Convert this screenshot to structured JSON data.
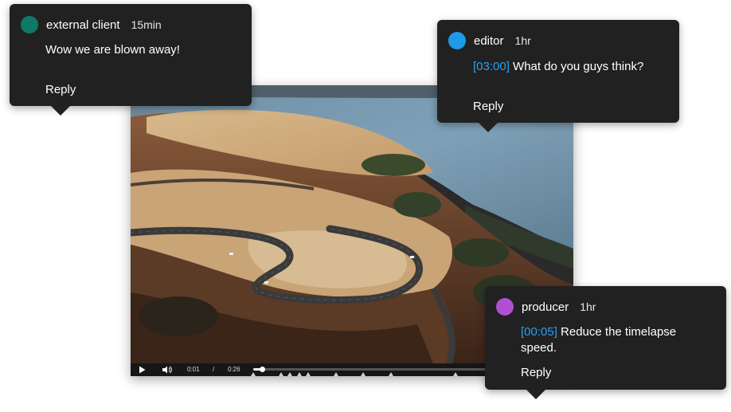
{
  "video": {
    "current_time": "0:01",
    "separator": "/",
    "duration": "0:26",
    "progress_fraction": 0.038,
    "comment_marker_times": [
      "0:00",
      "0:03",
      "0:04",
      "0:05",
      "0:06",
      "0:09",
      "0:12",
      "0:15",
      "0:22"
    ]
  },
  "comments": [
    {
      "author": "external client",
      "time_ago": "15min",
      "avatar_color": "#0e7a66",
      "timestamp": "",
      "message": "Wow we are blown away!",
      "reply_label": "Reply"
    },
    {
      "author": "editor",
      "time_ago": "1hr",
      "avatar_color": "#1e9be8",
      "timestamp": "[03:00]",
      "message": " What do you guys think?",
      "reply_label": "Reply"
    },
    {
      "author": "producer",
      "time_ago": "1hr",
      "avatar_color": "#b04fd0",
      "timestamp": "[00:05]",
      "message": " Reduce the timelapse speed.",
      "reply_label": "Reply"
    }
  ],
  "icons": {
    "play": "play-icon",
    "volume": "volume-icon"
  },
  "colors": {
    "bubble_bg": "#212121",
    "timestamp_link": "#2aa1f0"
  }
}
